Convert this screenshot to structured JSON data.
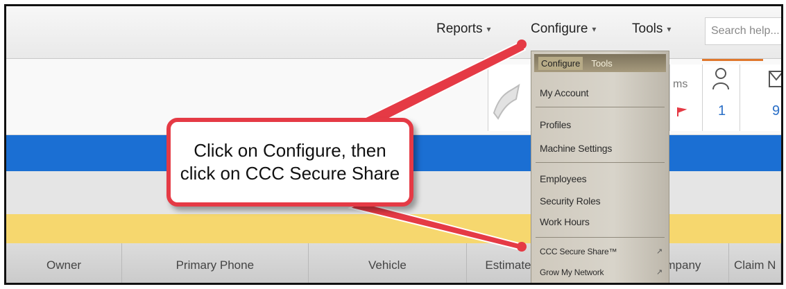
{
  "topnav": {
    "reports": "Reports",
    "configure": "Configure",
    "tools": "Tools",
    "search_placeholder": "Search help..."
  },
  "header_partial": {
    "items_fragment": "ms",
    "user_count": "1",
    "mail_count": "9"
  },
  "dropdown": {
    "top_configure": "Configure",
    "top_tools": "Tools",
    "items": [
      "My Account",
      "Profiles",
      "Machine Settings",
      "Employees",
      "Security Roles",
      "Work Hours",
      "CCC Secure Share™",
      "Grow My Network"
    ]
  },
  "callout": {
    "text": "Click on Configure, then click on CCC Secure Share"
  },
  "table": {
    "columns": [
      "Owner",
      "Primary Phone",
      "Vehicle",
      "Estimate",
      "mpany",
      "Claim N"
    ]
  },
  "colors": {
    "highlight_red": "#e53a45",
    "band_blue": "#1b6fd3",
    "band_yellow": "#f6d76e",
    "accent_orange": "#e0772b"
  }
}
